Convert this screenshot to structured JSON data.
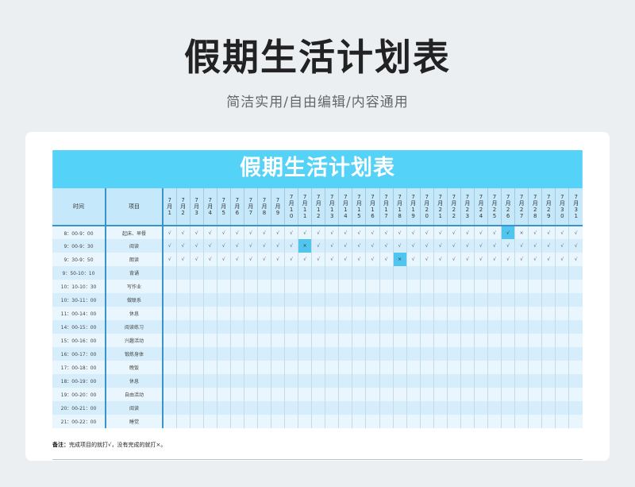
{
  "header": {
    "title": "假期生活计划表",
    "subtitle": "简洁实用/自由编辑/内容通用"
  },
  "sheet": {
    "title": "假期生活计划表",
    "col_time": "时间",
    "col_item": "项目",
    "days": [
      "7月1",
      "7月2",
      "7月3",
      "7月4",
      "7月5",
      "7月6",
      "7月7",
      "7月8",
      "7月9",
      "7月10",
      "7月11",
      "7月12",
      "7月13",
      "7月14",
      "7月15",
      "7月16",
      "7月17",
      "7月18",
      "7月19",
      "7月20",
      "7月21",
      "7月22",
      "7月23",
      "7月24",
      "7月25",
      "7月26",
      "7月27",
      "7月28",
      "7月29",
      "7月30",
      "7月31"
    ],
    "check_mark": "√",
    "cross_mark": "×",
    "rows": [
      {
        "time": "8：00-9：00",
        "item": "起床、早餐",
        "marks": "ccccccccccccccccccccccccccxccccc",
        "hl": [
          25
        ]
      },
      {
        "time": "9：00-9：30",
        "item": "阅读",
        "marks": "ccccccccccxcccccccccccccccccccc",
        "hl": [
          10
        ]
      },
      {
        "time": "9：30-9：50",
        "item": "朗读",
        "marks": "cccccccccccccccccxccccccccccccc",
        "hl": [
          17
        ]
      },
      {
        "time": "9：50-10：10",
        "item": "背诵",
        "marks": "",
        "hl": []
      },
      {
        "time": "10：10-10：30",
        "item": "写作业",
        "marks": "",
        "hl": []
      },
      {
        "time": "10：30-11：00",
        "item": "做联系",
        "marks": "",
        "hl": []
      },
      {
        "time": "11：00-14：00",
        "item": "休息",
        "marks": "",
        "hl": []
      },
      {
        "time": "14：00-15：00",
        "item": "阅读练习",
        "marks": "",
        "hl": []
      },
      {
        "time": "15：00-16：00",
        "item": "兴趣活动",
        "marks": "",
        "hl": []
      },
      {
        "time": "16：00-17：00",
        "item": "锻炼身体",
        "marks": "",
        "hl": []
      },
      {
        "time": "17：00-18：00",
        "item": "晚饭",
        "marks": "",
        "hl": []
      },
      {
        "time": "18：00-19：00",
        "item": "休息",
        "marks": "",
        "hl": []
      },
      {
        "time": "19：00-20：00",
        "item": "自由活动",
        "marks": "",
        "hl": []
      },
      {
        "time": "20：00-21：00",
        "item": "阅读",
        "marks": "",
        "hl": []
      },
      {
        "time": "21：00-22：00",
        "item": "睡觉",
        "marks": "",
        "hl": []
      }
    ]
  },
  "note": {
    "label": "备注：",
    "text": "完成项目的就打√，没有完成的就打×。"
  },
  "colors": {
    "accent": "#55d2f7",
    "header_bg": "#c6e8fb",
    "row_light": "#eaf6fd",
    "row_dark": "#d6eefb",
    "highlight": "#4fc5ef",
    "rule": "#3c93c9"
  }
}
